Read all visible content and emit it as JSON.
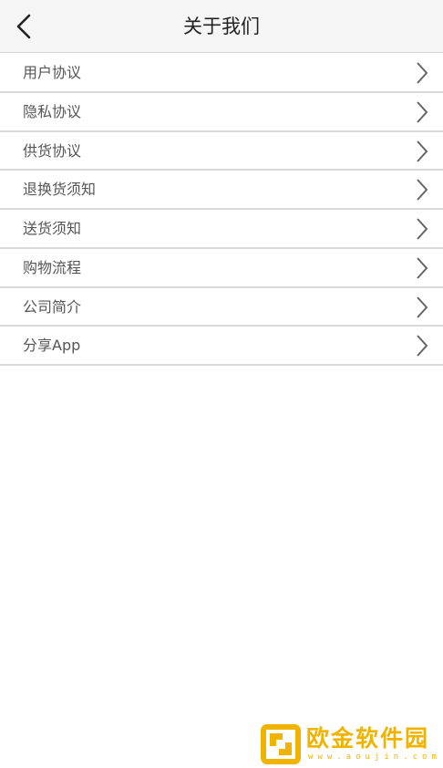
{
  "header": {
    "title": "关于我们",
    "back_icon": "chevron-left-icon"
  },
  "menu": {
    "items": [
      {
        "label": "用户协议"
      },
      {
        "label": "隐私协议"
      },
      {
        "label": "供货协议"
      },
      {
        "label": "退换货须知"
      },
      {
        "label": "送货须知"
      },
      {
        "label": "购物流程"
      },
      {
        "label": "公司简介"
      },
      {
        "label": "分享App"
      }
    ],
    "arrow_icon": "chevron-right-icon"
  },
  "watermark": {
    "brand": "欧金软件园",
    "url": "www.aoujin.com",
    "color": "#f0b400"
  }
}
